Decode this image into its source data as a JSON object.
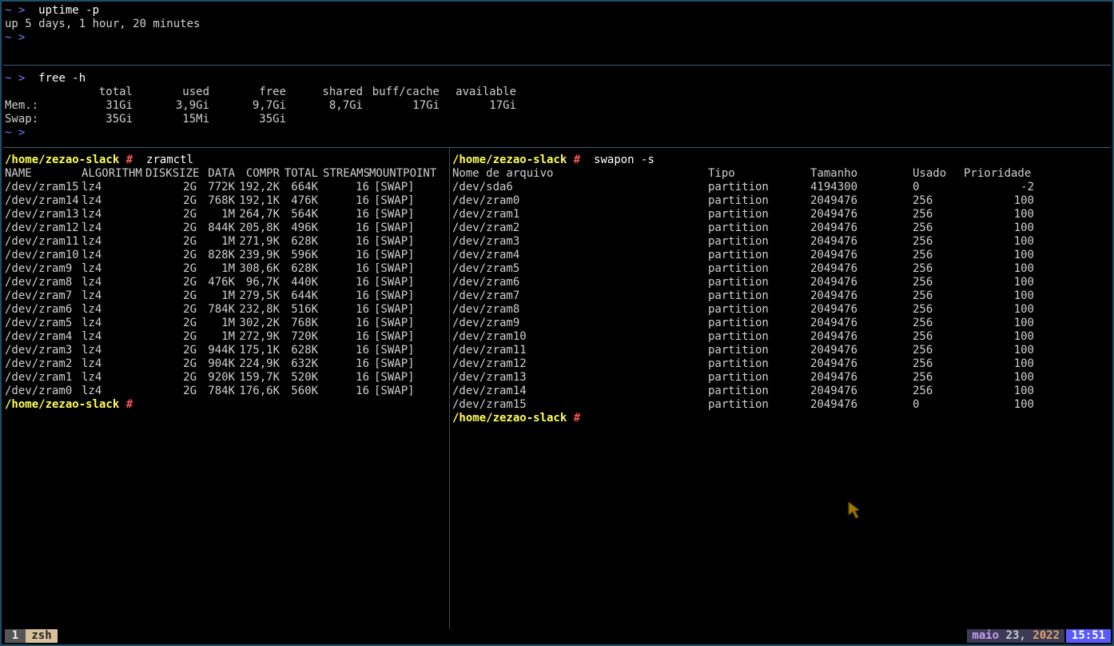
{
  "top_pane": {
    "prompt": "~ >",
    "cmd1": "uptime -p",
    "out1": "up 5 days, 1 hour, 20 minutes"
  },
  "mid_pane": {
    "prompt": "~ >",
    "cmd": "free -h",
    "headers": [
      "total",
      "used",
      "free",
      "shared",
      "buff/cache",
      "available"
    ],
    "rows": [
      {
        "label": "Mem.:",
        "values": [
          "31Gi",
          "3,9Gi",
          "9,7Gi",
          "8,7Gi",
          "17Gi",
          "17Gi"
        ]
      },
      {
        "label": "Swap:",
        "values": [
          "35Gi",
          "15Mi",
          "35Gi",
          "",
          "",
          ""
        ]
      }
    ]
  },
  "left_pane": {
    "path": "/home/zezao-slack",
    "hash": "#",
    "cmd": "zramctl",
    "headers": [
      "NAME",
      "ALGORITHM",
      "DISKSIZE",
      "DATA",
      "COMPR",
      "TOTAL",
      "STREAMS",
      "MOUNTPOINT"
    ],
    "rows": [
      [
        "/dev/zram15",
        "lz4",
        "2G",
        "772K",
        "192,2K",
        "664K",
        "16",
        "[SWAP]"
      ],
      [
        "/dev/zram14",
        "lz4",
        "2G",
        "768K",
        "192,1K",
        "476K",
        "16",
        "[SWAP]"
      ],
      [
        "/dev/zram13",
        "lz4",
        "2G",
        "1M",
        "264,7K",
        "564K",
        "16",
        "[SWAP]"
      ],
      [
        "/dev/zram12",
        "lz4",
        "2G",
        "844K",
        "205,8K",
        "496K",
        "16",
        "[SWAP]"
      ],
      [
        "/dev/zram11",
        "lz4",
        "2G",
        "1M",
        "271,9K",
        "628K",
        "16",
        "[SWAP]"
      ],
      [
        "/dev/zram10",
        "lz4",
        "2G",
        "828K",
        "239,9K",
        "596K",
        "16",
        "[SWAP]"
      ],
      [
        "/dev/zram9",
        "lz4",
        "2G",
        "1M",
        "308,6K",
        "628K",
        "16",
        "[SWAP]"
      ],
      [
        "/dev/zram8",
        "lz4",
        "2G",
        "476K",
        "96,7K",
        "440K",
        "16",
        "[SWAP]"
      ],
      [
        "/dev/zram7",
        "lz4",
        "2G",
        "1M",
        "279,5K",
        "644K",
        "16",
        "[SWAP]"
      ],
      [
        "/dev/zram6",
        "lz4",
        "2G",
        "784K",
        "232,8K",
        "516K",
        "16",
        "[SWAP]"
      ],
      [
        "/dev/zram5",
        "lz4",
        "2G",
        "1M",
        "302,2K",
        "768K",
        "16",
        "[SWAP]"
      ],
      [
        "/dev/zram4",
        "lz4",
        "2G",
        "1M",
        "272,9K",
        "720K",
        "16",
        "[SWAP]"
      ],
      [
        "/dev/zram3",
        "lz4",
        "2G",
        "944K",
        "175,1K",
        "628K",
        "16",
        "[SWAP]"
      ],
      [
        "/dev/zram2",
        "lz4",
        "2G",
        "904K",
        "224,9K",
        "632K",
        "16",
        "[SWAP]"
      ],
      [
        "/dev/zram1",
        "lz4",
        "2G",
        "920K",
        "159,7K",
        "520K",
        "16",
        "[SWAP]"
      ],
      [
        "/dev/zram0",
        "lz4",
        "2G",
        "784K",
        "176,6K",
        "560K",
        "16",
        "[SWAP]"
      ]
    ]
  },
  "right_pane": {
    "path": "/home/zezao-slack",
    "hash": "#",
    "cmd": "swapon -s",
    "headers": [
      "Nome de arquivo",
      "Tipo",
      "Tamanho",
      "Usado",
      "Prioridade"
    ],
    "rows": [
      [
        "/dev/sda6",
        "partition",
        "4194300",
        "0",
        "-2"
      ],
      [
        "/dev/zram0",
        "partition",
        "2049476",
        "256",
        "100"
      ],
      [
        "/dev/zram1",
        "partition",
        "2049476",
        "256",
        "100"
      ],
      [
        "/dev/zram2",
        "partition",
        "2049476",
        "256",
        "100"
      ],
      [
        "/dev/zram3",
        "partition",
        "2049476",
        "256",
        "100"
      ],
      [
        "/dev/zram4",
        "partition",
        "2049476",
        "256",
        "100"
      ],
      [
        "/dev/zram5",
        "partition",
        "2049476",
        "256",
        "100"
      ],
      [
        "/dev/zram6",
        "partition",
        "2049476",
        "256",
        "100"
      ],
      [
        "/dev/zram7",
        "partition",
        "2049476",
        "256",
        "100"
      ],
      [
        "/dev/zram8",
        "partition",
        "2049476",
        "256",
        "100"
      ],
      [
        "/dev/zram9",
        "partition",
        "2049476",
        "256",
        "100"
      ],
      [
        "/dev/zram10",
        "partition",
        "2049476",
        "256",
        "100"
      ],
      [
        "/dev/zram11",
        "partition",
        "2049476",
        "256",
        "100"
      ],
      [
        "/dev/zram12",
        "partition",
        "2049476",
        "256",
        "100"
      ],
      [
        "/dev/zram13",
        "partition",
        "2049476",
        "256",
        "100"
      ],
      [
        "/dev/zram14",
        "partition",
        "2049476",
        "256",
        "100"
      ],
      [
        "/dev/zram15",
        "partition",
        "2049476",
        "0",
        "100"
      ]
    ]
  },
  "status_bar": {
    "window_index": "1",
    "window_name": "zsh",
    "date_month": "maio",
    "date_day": "23,",
    "date_year": "2022",
    "time": "15:51"
  },
  "colors": {
    "border": "#1b4f6a",
    "prompt_path": "#ffff55",
    "prompt_hash": "#ff5555",
    "prompt_arrow": "#7a7aff",
    "clock_bg": "#5a5aff"
  },
  "icons": [
    "mouse-cursor-icon"
  ]
}
